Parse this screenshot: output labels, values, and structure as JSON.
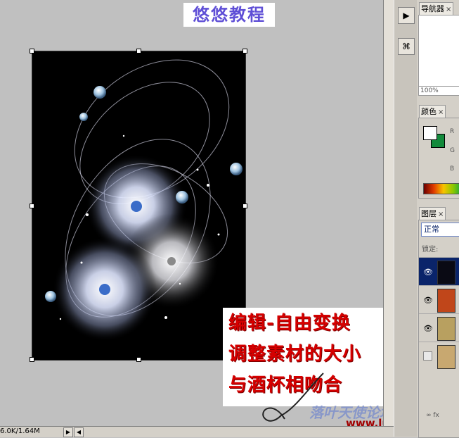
{
  "canvas": {
    "title_watermark": "悠悠教程",
    "annotation_lines": [
      "编辑-自由变换",
      "调整素材的大小",
      "与酒杯相吻合"
    ],
    "site_watermark": "落叶天使论坛",
    "site_url": "www.luoan.cn"
  },
  "status_bar": {
    "doc_size": "6.0K/1.64M",
    "arrow": "▶",
    "scroll_left": "◀"
  },
  "toolstrip": {
    "buttons": [
      {
        "name": "play-action",
        "icon": "▶"
      },
      {
        "name": "brush-preset",
        "icon": "⌘"
      }
    ]
  },
  "panels": {
    "navigator": {
      "tab": "导航器",
      "zoom": "100%"
    },
    "color": {
      "tab": "颜色",
      "r": "R",
      "g": "G",
      "b": "B",
      "fg_color": "#ffffff",
      "bg_color": "#128a3b"
    },
    "layers": {
      "tab": "图层",
      "blend_mode": "正常",
      "lock_label": "锁定:",
      "footer_icons": "∞ fx",
      "rows": [
        {
          "visible": true,
          "selected": true,
          "thumb": "#0a0a14"
        },
        {
          "visible": true,
          "selected": false,
          "thumb": "#c0461a"
        },
        {
          "visible": true,
          "selected": false,
          "thumb": "#b8a060"
        },
        {
          "visible": false,
          "selected": false,
          "thumb": "#c8a870"
        }
      ]
    }
  },
  "close_glyph": "×",
  "eye_glyph": "👁"
}
